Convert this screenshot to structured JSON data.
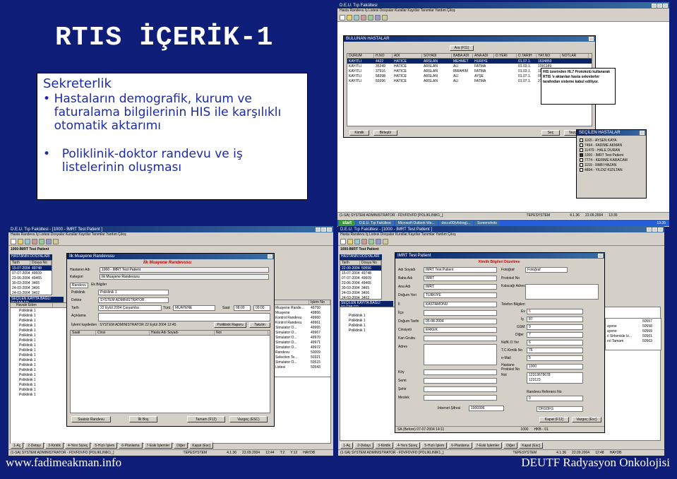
{
  "slide": {
    "title": "RTIS İÇERİK-1",
    "section": "Sekreterlik",
    "bullets": [
      "Hastaların demografik, kurum ve faturalama bilgilerinin HIS ile karşılıklı otomatik aktarımı",
      "Poliklinik-doktor randevu ve iş listelerinin oluşması"
    ],
    "bullet_symbol": "•",
    "footer_left": "www.fadimeakman.info",
    "footer_right": "DEUTF Radyasyon Onkolojisi"
  },
  "shot1": {
    "app_title": "D.E.U. Tıp Fakültesi",
    "menu": "Hasta  Randevu  İş Listesi  Dosyalar  Kurallar  Kayıtlar  Tanımlar  Yardım  Çıkış",
    "dialog_title": "BULUNAN HASTALAR",
    "search_button": "Ara (F11)",
    "columns": [
      "DURUM",
      "H.NO",
      "ADI",
      "SOYADI",
      "BABA ADI",
      "ANA ADI",
      "D.YERİ",
      "D.TARİH",
      "YAT.NO",
      "NOTLAR"
    ],
    "rows": [
      [
        "KAYITLI",
        "4422",
        "HATİCE",
        "ARSLAN",
        "MEHMET",
        "HÜRİYE",
        "",
        "01.07.1.",
        "1634859",
        ""
      ],
      [
        "KAYITLI",
        "35249",
        "HATİCE",
        "ARSLAN",
        "ALİ",
        "FATMA",
        "",
        "01.03.1.",
        "1091189",
        ""
      ],
      [
        "KAYITLI",
        "37916",
        "HATİCE",
        "ARSLAN",
        "İBRAHİM",
        "FATMA",
        "",
        "01.03.1.",
        "1094198",
        ""
      ],
      [
        "KAYITLI",
        "58398",
        "HATİCE",
        "ARSLAN",
        "ALİ",
        "AYŞE",
        "",
        "01.07.1.",
        "0952264",
        ""
      ],
      [
        "KAYITLI",
        "59396",
        "HATİCE",
        "ARSLAN",
        "ALİ",
        "FATMA",
        "",
        "01.07.1.",
        "215825",
        ""
      ]
    ],
    "note": "HIS üzerinden HL7 Protokolü kullanarak RTIS 'e aktarılan hasta sekreterler tarafından sisteme kabul ediliyor.",
    "btn_kimlik": "Kimlik",
    "btn_birlestir": "Birleştir",
    "btn_sec": "Seç",
    "btn_vazgec": "Vazgeç",
    "sub_title": "SEÇİLEN HASTALAR",
    "sub_items": [
      "1165 - AYSEN KAYA",
      "7494 - FADİME AKMAN",
      "11479 - HALE DURAN",
      "1000 - İMRT Test Patient",
      "7774 - KERİME KARACAM",
      "1159 - RABİ HAZAN",
      "4894 - YILDIZ KIZILTAN"
    ],
    "status": "(1-SA) SYSTEM ADMINISTRATOR - FDVFDVFD [POLIKLINIK1_]",
    "station": "TEPESYSTEM",
    "version": "4.1.36",
    "date": "22.09.2004",
    "time": "13:35",
    "start": "start",
    "tasks": [
      "D.E.U. Tıp Fakültesi",
      "Microsoft Outlook We...",
      "deu-s00(vfstreg)...",
      "Screenshots"
    ],
    "clock": "13:35"
  },
  "shot2": {
    "app_title": "D.E.U. Tıp Fakültesi - [1000 - İMRT Test Patient ]",
    "menu": "Hasta  Randevu  İş Listesi  Dosyalar  Kurallar  Kayıtlar  Tanımlar  Yardım  Çıkış",
    "patient_label": "1000-İMRT Test Patient",
    "files_header": "HASTANIN DOSYALARI",
    "files_cols": [
      "Tarih",
      "Dosya No"
    ],
    "files": [
      [
        "15-07-2004",
        "49748"
      ],
      [
        "07-07-2004",
        "49609"
      ],
      [
        "23-06-2004",
        "49465"
      ],
      [
        "30-03-2004",
        "3465"
      ],
      [
        "24-03-2004",
        "3406"
      ],
      [
        "24-03-2004",
        "3402"
      ]
    ],
    "sel_header": "SEÇİLEN KAYITA BAĞLI İŞLEMLER",
    "sel_cols": [
      "Havale Eden"
    ],
    "sel_rows": [
      "Poliklinik 1",
      "Poliklinik 1",
      "Poliklinik 1",
      "Poliklinik 1",
      "Poliklinik 1",
      "Poliklinik 1",
      "Poliklinik 1",
      "Poliklinik 1",
      "Poliklinik 1",
      "Poliklinik 1",
      "Poliklinik 1",
      "Poliklinik 1",
      "Poliklinik 1",
      "Poliklinik 1",
      "Poliklinik 1",
      "Poliklinik 1",
      "Poliklinik 1",
      "Poliklinik 1"
    ],
    "right_cols": [
      "İşlem No"
    ],
    "right_rows": [
      [
        "Muayene Rande...",
        "49750"
      ],
      [
        "Muayene",
        "49866"
      ],
      [
        "Kontrol Randevu",
        "49960"
      ],
      [
        "Kontrol Randevu",
        "49961"
      ],
      [
        "Simulator O...",
        "49965"
      ],
      [
        "Simulator O...",
        "49967"
      ],
      [
        "Simulator O...",
        "49970"
      ],
      [
        "Simulator O...",
        "49971"
      ],
      [
        "Simulator O...",
        "49972"
      ],
      [
        "Randevu",
        "50009"
      ],
      [
        "Selection Te...",
        "50321"
      ],
      [
        "Simulator O...",
        "50515"
      ],
      [
        "Listesi",
        "50543"
      ]
    ],
    "dialog_title": "İlk Muayene Randevusu",
    "dialog_heading": "İlk Muayene Randevusu",
    "f_hasta_label": "Hastanın Adı",
    "f_hasta": "1000 - İMRT Test Patient",
    "f_kategori_label": "Kategori",
    "f_kategori": "İlk Muayene Randevusu",
    "tab1": "Randevu",
    "tab2": "Ek Bilgiler",
    "f_poli_label": "Poliklinik",
    "f_poli": "Poliklinik 1",
    "f_doktor_label": "Doktor",
    "f_doktor": "SYSTEM ADMINISTRATOR",
    "f_tarih_label": "Tarih",
    "f_tarih": "22   Eylül   2004 Çarşamba",
    "f_turu_label": "Türü",
    "f_turu": "MUAYENE",
    "f_saat_label": "Saat",
    "f_saat1": "08:00",
    "f_saat2": "09:00",
    "f_aciklama_label": "Açıklama",
    "f_islem": "İşlemi kaydeden : SYSTEM ADMINISTRATOR 22 Eylül 2004 12:45",
    "btn_pol_rapor": "Poliklinik Raporu",
    "btn_takvim": "Takvim",
    "list_cols": [
      "Saati",
      "Cinsi",
      "Hasta Adı Soyadı",
      "Not"
    ],
    "btn_saatsiz": "Saatsiz Randevu",
    "btn_ilk_bos": "İlk Boş",
    "btn_tamam": "Tamam (F12)",
    "btn_vazgec": "Vazgeç (ESC)",
    "fkeys": [
      "1-Aç",
      "2-Detayı",
      "3-Kimlik",
      "4-Yeni Süreç",
      "5-Hızlı İşlem",
      "6-Planlama",
      "7-Eski İşlemler",
      "Diğer",
      "Kapat (Esc)"
    ],
    "status": "(1-SA) SYSTEM ADMINISTRATOR - FDVFDVFD [POLIKLINIK1_]",
    "station": "TEPESYSTEM",
    "version": "4.1.36",
    "date": "22.09.2004",
    "time": "12:44",
    "mode": "T:2",
    "caps": "Y:12",
    "db": "HAYDB"
  },
  "shot3": {
    "app_title": "D.E.U. Tıp Fakültesi - [1000 - İMRT Test Patient ]",
    "menu": "Hasta  Randevu  İş Listesi  Dosyalar  Kurallar  Kayıtlar  Tanımlar  Yardım  Çıkış",
    "patient_label": "1000-İMRT Test Patient",
    "files_header": "HASTANIN DOSYALARI",
    "files_cols": [
      "Tarih",
      "Dosya No"
    ],
    "files": [
      [
        "22-09-2004",
        "50556"
      ],
      [
        "15-07-2004",
        "49748"
      ],
      [
        "07-07-2004",
        "49609"
      ],
      [
        "23-06-2004",
        "49465"
      ],
      [
        "30-03-2004",
        "3465"
      ],
      [
        "24-03-2004",
        "3406"
      ],
      [
        "24-03-2004",
        "3402"
      ]
    ],
    "sel_header": "SEÇİLEN KAYITA BAĞLI İŞLEMLER",
    "sel_rows": [
      "Poliklinik 1",
      "Poliklinik 1",
      "Poliklinik 1",
      "Poliklinik 1"
    ],
    "right_rows": [
      [
        "",
        "50557"
      ],
      [
        "ayene",
        "50558"
      ],
      [
        "ayene",
        "50559"
      ],
      [
        "ıl Sirkenisle İz...",
        "50561"
      ],
      [
        "rol Tamam",
        "50563"
      ]
    ],
    "dialog_title": "IMRT Test Patient",
    "dialog_heading": "Kimlik Bilgileri Düzeltme",
    "l_adi": "Adı Soyadı",
    "v_adi": "İMRT Test Patient",
    "l_baba": "Baba Adı",
    "v_baba": "İMRT",
    "l_ana": "Ana Adı",
    "v_ana": "İMRT",
    "l_dogum_yeri": "Doğum Yeri",
    "v_dogum_yeri": "TÜRKİYE",
    "l_il": "İl",
    "v_il": "KASTAMONU",
    "l_ilce": "İlçe",
    "l_dogum_tarihi": "Doğum Tarihi",
    "v_dogum_tarihi": "05-08-2004",
    "l_cinsiyet": "Cinsiyeti",
    "v_cinsiyet": "ERKEK",
    "l_kan": "Kan Grubu",
    "l_adres": "Adres",
    "l_koy": "Köy",
    "l_semt": "Semt",
    "l_sehir": "Şehir",
    "l_meslek": "Meslek",
    "l_foto": "Fotoğraf",
    "l_protokol": "Protokol No",
    "l_kalacagi": "Kalacağı Adres",
    "l_telefon": "Telefon Bilgileri",
    "l_ev": "Ev",
    "v_ev": "6",
    "l_is": "İş",
    "v_is": "87",
    "l_gsm": "GSM",
    "v_gsm": "9",
    "l_diger": "Diğer",
    "v_diger": "7",
    "l_nufus": "NüfK.O.Yer",
    "v_nufus": "6",
    "l_tc": "T.C.Kimlik No",
    "v_tc": "76",
    "l_email": "e-Mail",
    "v_email": "5",
    "l_hprot": "Hastane Protokol No",
    "v_hprot": "1000",
    "l_not": "Not",
    "v_not1": "12313678678",
    "v_not2": "123123",
    "l_randevu": "Randevu Referans No",
    "v_randevu": "0",
    "v_extra": "DFGDFG",
    "l_internet": "İnternet Şifresi",
    "v_internet": "1000306",
    "btn_kapat": "Kapat (F12)",
    "btn_vazgec": "Vazgeç (Esc)",
    "dlg_status": "SA (Before) 07-07-2004 14:11",
    "dlg_status2": "1000",
    "dlg_status3": "HKB - 01",
    "fkeys": [
      "1-Aç",
      "2-Detayı",
      "3-Kimlik",
      "4-Yeni Süreç",
      "5-Hızlı İşlem",
      "6-Planlama",
      "7-Eski İşlemler",
      "Diğer",
      "Kapat (Esc)"
    ],
    "status": "(1-SA) SYSTEM ADMINISTRATOR - FDVFDVFD [POLIKLINIK1_]",
    "station": "TEPESYSTEM",
    "version": "4.1.36",
    "date": "22.09.2004",
    "time": "12:48",
    "db": "HAYDB"
  },
  "colors": {
    "background": "#0e1d78",
    "title": "#ffffff",
    "text_blue": "#1a2aa8",
    "titlebar": "#0a246a",
    "dialog_face": "#d4d0c8",
    "selection": "#0a246a"
  }
}
